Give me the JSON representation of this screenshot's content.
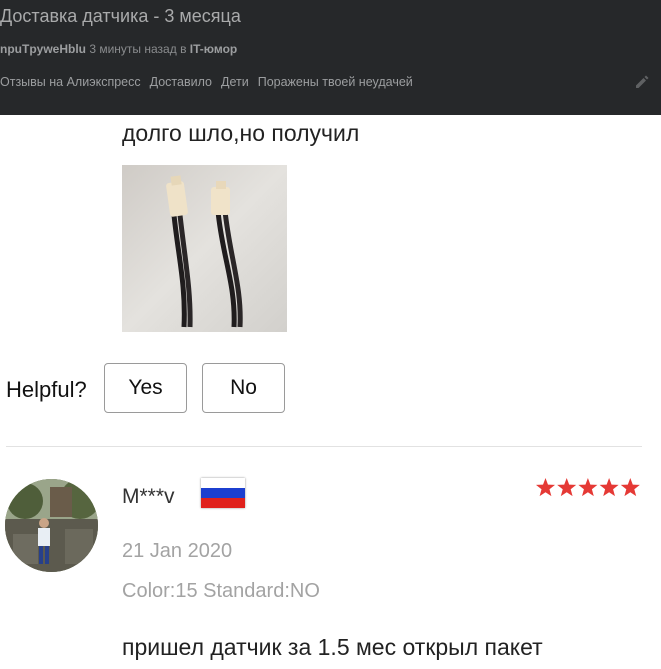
{
  "post": {
    "title": "Доставка датчика - 3 месяца",
    "author": "npuTpyweHblu",
    "time_ago": "3 минуты назад в",
    "community": "IT-юмор",
    "tags": [
      "Отзывы на Алиэкспресс",
      "Доставило",
      "Дети",
      "Поражены твоей неудачей"
    ],
    "edit_icon": "pencil-icon"
  },
  "review1": {
    "text": "долго шло,но получил",
    "photo": "photo of two sensor probes with black wires"
  },
  "helpful": {
    "label": "Helpful?",
    "yes_label": "Yes",
    "no_label": "No"
  },
  "review2": {
    "username": "M***v",
    "flag": "russia-flag",
    "rating": 5,
    "rating_max": 5,
    "star_color": "#e53935",
    "date": "21 Jan 2020",
    "sku": "Color:15 Standard:NO",
    "text": "пришел датчик за 1.5 мес открыл пакет"
  },
  "colors": {
    "header_bg": "#26282a",
    "star": "#e53935"
  }
}
